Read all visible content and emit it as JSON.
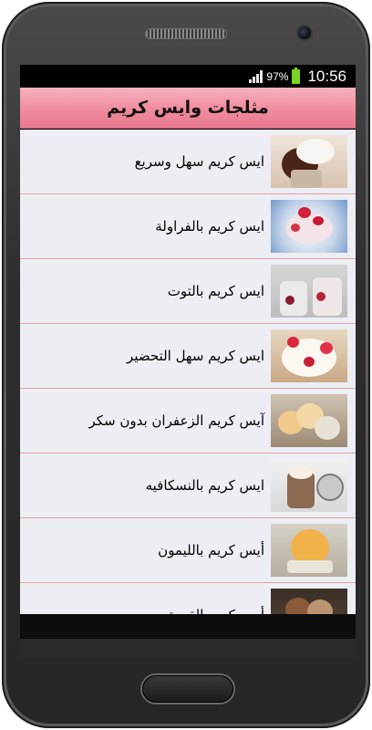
{
  "status_bar": {
    "battery_percent": "97%",
    "time": "10:56"
  },
  "app_bar": {
    "title": "مثلجات وايس كريم"
  },
  "recipes": [
    {
      "label": "ايس كريم سهل وسريع",
      "icon": "chocolate-sundae-image"
    },
    {
      "label": "ايس كريم بالفراولة",
      "icon": "strawberry-ice-cream-image"
    },
    {
      "label": "ايس كريم بالتوت",
      "icon": "berry-parfait-image"
    },
    {
      "label": "ايس كريم سهل التحضير",
      "icon": "strawberry-cream-bowl-image"
    },
    {
      "label": "آيس كريم الزعفران بدون سكر",
      "icon": "saffron-scoops-image"
    },
    {
      "label": "ايس كريم بالنسكافيه",
      "icon": "coffee-glass-image"
    },
    {
      "label": "أيس كريم بالليمون",
      "icon": "lemon-sorbet-image"
    },
    {
      "label": "أيس كريم القهوة",
      "icon": "coffee-scoops-image"
    }
  ],
  "colors": {
    "app_bar": "#f08c9e",
    "list_background": "#eceef3",
    "divider": "#e1a1ad",
    "battery": "#7bd321"
  }
}
